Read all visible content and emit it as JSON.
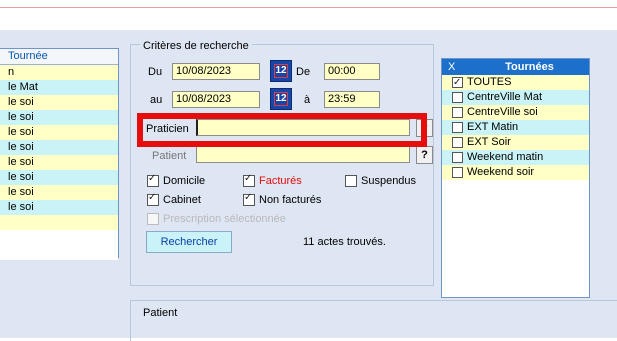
{
  "left_list": {
    "header": "Tournée",
    "rows": [
      {
        "label": "n",
        "style": "y"
      },
      {
        "label": "le Mat",
        "style": "c"
      },
      {
        "label": "le soi",
        "style": "y"
      },
      {
        "label": "le soi",
        "style": "c"
      },
      {
        "label": "le soi",
        "style": "y"
      },
      {
        "label": "le soi",
        "style": "c"
      },
      {
        "label": "le soi",
        "style": "y"
      },
      {
        "label": "le soi",
        "style": "c"
      },
      {
        "label": "le soi",
        "style": "y"
      },
      {
        "label": "le soi",
        "style": "c"
      },
      {
        "label": "",
        "style": "y"
      },
      {
        "label": "",
        "style": "e"
      },
      {
        "label": "",
        "style": "e"
      }
    ]
  },
  "search": {
    "title": "Critères de recherche",
    "du_label": "Du",
    "date_from": "10/08/2023",
    "de_label": "De",
    "time_from": "00:00",
    "au_label": "au",
    "date_to": "10/08/2023",
    "a_label": "à",
    "time_to": "23:59",
    "calendar_icon_text": "12",
    "praticien_label": "Praticien",
    "praticien_value": "",
    "patient_label": "Patient",
    "patient_value": "",
    "lookup_label": "?",
    "checkboxes": {
      "domicile": "Domicile",
      "factures": "Facturés",
      "suspendus": "Suspendus",
      "cabinet": "Cabinet",
      "non_factures": "Non facturés",
      "prescription": "Prescription sélectionnée"
    },
    "search_button": "Rechercher",
    "result_text": "11 actes trouvés."
  },
  "patient_group": {
    "title": "Patient"
  },
  "tournees": {
    "col_x": "X",
    "col_title": "Tournées",
    "items": [
      {
        "label": "TOUTES",
        "checked": true,
        "style": "y"
      },
      {
        "label": "CentreVille Mat",
        "checked": false,
        "style": "c"
      },
      {
        "label": "CentreVille soi",
        "checked": false,
        "style": "y"
      },
      {
        "label": "EXT Matin",
        "checked": false,
        "style": "c"
      },
      {
        "label": "EXT Soir",
        "checked": false,
        "style": "y"
      },
      {
        "label": "Weekend matin",
        "checked": false,
        "style": "c"
      },
      {
        "label": "Weekend soir",
        "checked": false,
        "style": "y"
      }
    ]
  },
  "colors": {
    "accent_red": "#e60d0d",
    "header_blue": "#1c6fcb",
    "row_yellow": "#ffffc6",
    "row_cyan": "#c9f3f6"
  }
}
